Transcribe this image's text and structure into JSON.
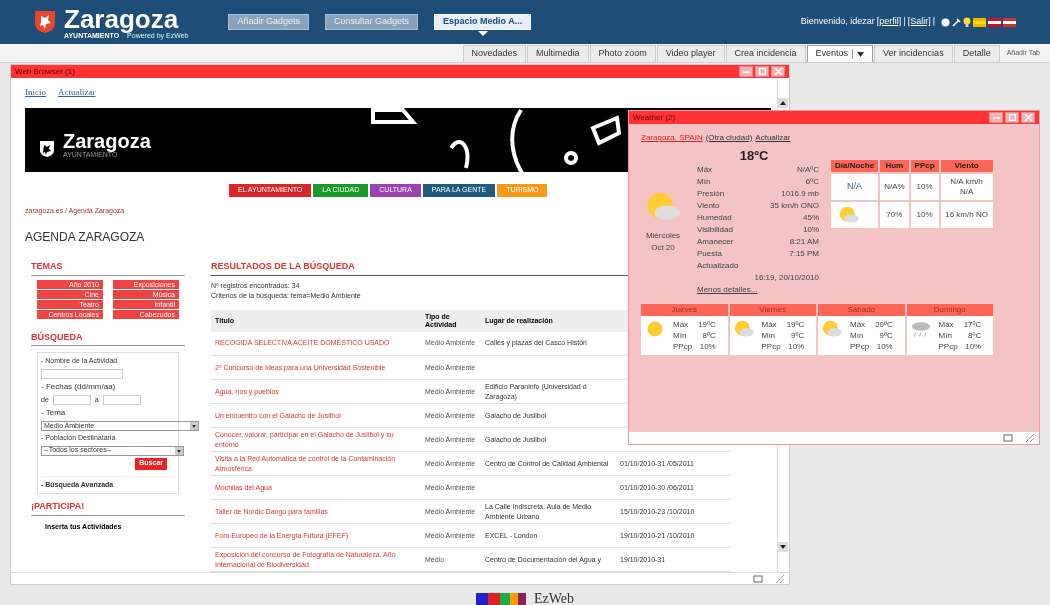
{
  "header": {
    "brand": "Zaragoza",
    "brand_sub": "AYUNTAMIENTO",
    "powered": "Powered by EzWeb",
    "buttons": [
      {
        "label": "Añadir Gadgets",
        "selected": false
      },
      {
        "label": "Consultar Gadgets",
        "selected": false
      },
      {
        "label": "Espacio Medio A...",
        "selected": true
      }
    ],
    "welcome": "Bienvenido, idezar",
    "links": [
      "[perfil]",
      "|",
      "[Salir]",
      "|"
    ]
  },
  "tabs": [
    {
      "label": "Novedades",
      "selected": false,
      "menu": false
    },
    {
      "label": "Multimedia",
      "selected": false,
      "menu": false
    },
    {
      "label": "Photo zoom",
      "selected": false,
      "menu": false
    },
    {
      "label": "Video player",
      "selected": false,
      "menu": false
    },
    {
      "label": "Crea incidencia",
      "selected": false,
      "menu": false
    },
    {
      "label": "Eventos",
      "selected": true,
      "menu": true
    },
    {
      "label": "Ver incidencias",
      "selected": false,
      "menu": false
    },
    {
      "label": "Detalle",
      "selected": false,
      "menu": false
    }
  ],
  "add_tab": "Añadir Tab",
  "browser": {
    "title": "Web Browser (1)",
    "links": [
      "Inicio",
      "Actualizar"
    ],
    "banner": {
      "brand": "Zaragoza",
      "sub": "AYUNTAMIENTO"
    },
    "nav": [
      {
        "label": "EL AYUNTAMIENTO",
        "color": "#d9262b"
      },
      {
        "label": "LA CIUDAD",
        "color": "#1a9a2a"
      },
      {
        "label": "CULTURA",
        "color": "#9a44b4"
      },
      {
        "label": "PARA LA GENTE",
        "color": "#1f5a80"
      },
      {
        "label": "TURISMO",
        "color": "#f59a1b"
      }
    ],
    "breadcrumb": "zaragoza.es / Agenda Zaragoza",
    "heading": "AGENDA ZARAGOZA",
    "temas": {
      "title": "TEMAS",
      "tiles": [
        "Año 2010",
        "Exposiciones",
        "Cine",
        "Música",
        "Teatro",
        "Infantil",
        "Centros Locales",
        "Cabezudos"
      ]
    },
    "search": {
      "title": "BÚSQUEDA",
      "name_label": "- Nombre de la Actividad",
      "dates_label": "- Fechas (dd/mm/aa)",
      "from": "de",
      "to": "a",
      "tema_label": "- Tema",
      "tema_value": "Medio Ambiente",
      "pop_label": "- Población Destinataria",
      "pop_value": "--Todos los sectores--",
      "button": "Buscar",
      "advanced": "- Búsqueda Avanzada"
    },
    "participa": {
      "title": "¡PARTICIPA!",
      "link": "Inserta tus Actividades"
    },
    "results": {
      "title": "RESULTADOS DE LA BÚSQUEDA",
      "count": "Nº registros encontrados: 34",
      "criteria": "Criterios de la búsqueda: tema=Medio Ambiente",
      "columns": [
        "Título",
        "Tipo de Actividad",
        "Lugar de realización"
      ],
      "rows": [
        {
          "title": "RECOGIDA SELECTIVA ACEITE DOMÉSTICO USADO",
          "type": "Medio Ambiente",
          "place": "Calles y plazas del Casco Históri"
        },
        {
          "title": "2º Concurso de Ideas para una Universidad Sostenible",
          "type": "Medio Ambiente"
        },
        {
          "title": "Agua, ríos y pueblos",
          "type": "Medio Ambiente",
          "place": "Edificio Paraninfo (Universidad d Zaragoza)"
        },
        {
          "title": "Un encuentro con el Galacho de Juslibol",
          "type": "Medio Ambiente",
          "place": "Galacho de Juslibol"
        },
        {
          "title": "Conocer, valorar, participar en el Galacho de Juslibol y su entorno",
          "type": "Medio Ambiente",
          "place": "Galacho de Juslibol"
        },
        {
          "title": "Visita a la Red Automática de control de la Contaminación Atmosférica",
          "type": "Medio Ambiente",
          "place": "Centro de Control de Calidad Ambiental",
          "date": "01/10/2010-31 /05/2011"
        },
        {
          "title": "Mochilas del Agua",
          "type": "Medio Ambiente",
          "date": "01/10/2010-30 /06/2011"
        },
        {
          "title": "Taller de Nordic Dango para familias",
          "type": "Medio Ambiente",
          "place": "La Calle Indiscreta. Aula de Medio Ambiente Urbano",
          "date": "15/10/2010-23 /10/2010"
        },
        {
          "title": "Foro Europeo de la Energía Futura (EFEF)",
          "type": "Medio Ambiente",
          "place": "EXCEL - London",
          "date": "19/10/2010-21 /10/2010"
        },
        {
          "title": "Exposición del concurso de Fotografía de Naturaleza. Año Internacional de Biodiversidad",
          "type": "Medio",
          "place": "Centro de Documentación del Agua y",
          "date": "19/10/2010-31"
        }
      ]
    }
  },
  "weather": {
    "title": "Weather (2)",
    "links": [
      "Zaragoza, SPAIN",
      "(Otra ciudad)",
      "Actualizar"
    ],
    "temp": "18ºC",
    "day": "Miércoles",
    "date": "Oct 20",
    "details": [
      [
        "Máx",
        "N/AºC"
      ],
      [
        "Mín",
        "6ºC"
      ],
      [
        "Presión",
        "1016.9 mb"
      ],
      [
        "Viento",
        "35 km/h ONO"
      ],
      [
        "Humedad",
        "45%"
      ],
      [
        "Visibilidad",
        "10%"
      ],
      [
        "Amanecer",
        "8:21 AM"
      ],
      [
        "Puesta",
        "7:15 PM"
      ]
    ],
    "updated_label": "Actualizado",
    "updated": "16:19, 20/10/2010",
    "less": "Menos detalles...",
    "dn_columns": [
      "Día/Noche",
      "Hum",
      "PPcp",
      "Viento"
    ],
    "dn_rows": [
      {
        "kind": "text",
        "icon_text": "N/A",
        "hum": "N/A%",
        "ppcp": "10%",
        "wind": "N/A km/h N/A"
      },
      {
        "kind": "partly",
        "hum": "70%",
        "ppcp": "10%",
        "wind": "16 km/h NO"
      }
    ],
    "forecast": [
      {
        "day": "Jueves",
        "kind": "sun",
        "labels": [
          "Máx",
          "Mín",
          "PPcp"
        ],
        "max": "19ºC",
        "min": "8ºC",
        "ppcp": "10%"
      },
      {
        "day": "Viernes",
        "kind": "partly",
        "labels": [
          "Máx",
          "Mín",
          "PPcp"
        ],
        "max": "19ºC",
        "min": "9ºC",
        "ppcp": "10%"
      },
      {
        "day": "Sábado",
        "kind": "partly",
        "labels": [
          "Máx",
          "Mín",
          "PPcp"
        ],
        "max": "20ºC",
        "min": "9ºC",
        "ppcp": "10%"
      },
      {
        "day": "Domingo",
        "kind": "rain",
        "labels": [
          "Máx",
          "Mín",
          "PPcp"
        ],
        "max": "17ºC",
        "min": "8ºC",
        "ppcp": "10%"
      }
    ]
  },
  "footer": {
    "logo": "EzWeb"
  }
}
